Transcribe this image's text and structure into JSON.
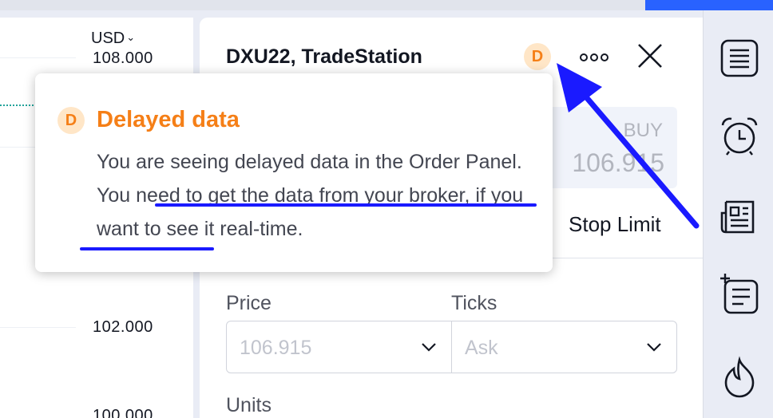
{
  "chart": {
    "currency": "USD",
    "ticks": [
      "108.000",
      "102.000",
      "100.000"
    ]
  },
  "panel": {
    "title": "DXU22, TradeStation",
    "badge_letter": "D",
    "buy_label": "BUY",
    "buy_value": "106.915",
    "tab_stop_limit": "Stop Limit",
    "price_label": "Price",
    "price_value": "106.915",
    "ticks_label": "Ticks",
    "ticks_value": "Ask",
    "units_label": "Units"
  },
  "tooltip": {
    "badge_letter": "D",
    "title": "Delayed data",
    "body": "You are seeing delayed data in the Order Panel. You need to get the data from your broker, if you want to see it real-time."
  },
  "colors": {
    "accent": "#2962ff",
    "delayed_orange": "#f57f17",
    "delayed_badge_bg": "#ffe6c7",
    "annotation_blue": "#1a1aff"
  },
  "icons": [
    "list-icon",
    "alarm-clock-icon",
    "news-icon",
    "add-list-icon",
    "fire-icon",
    "more-icon",
    "close-icon",
    "chevron-down-icon"
  ]
}
